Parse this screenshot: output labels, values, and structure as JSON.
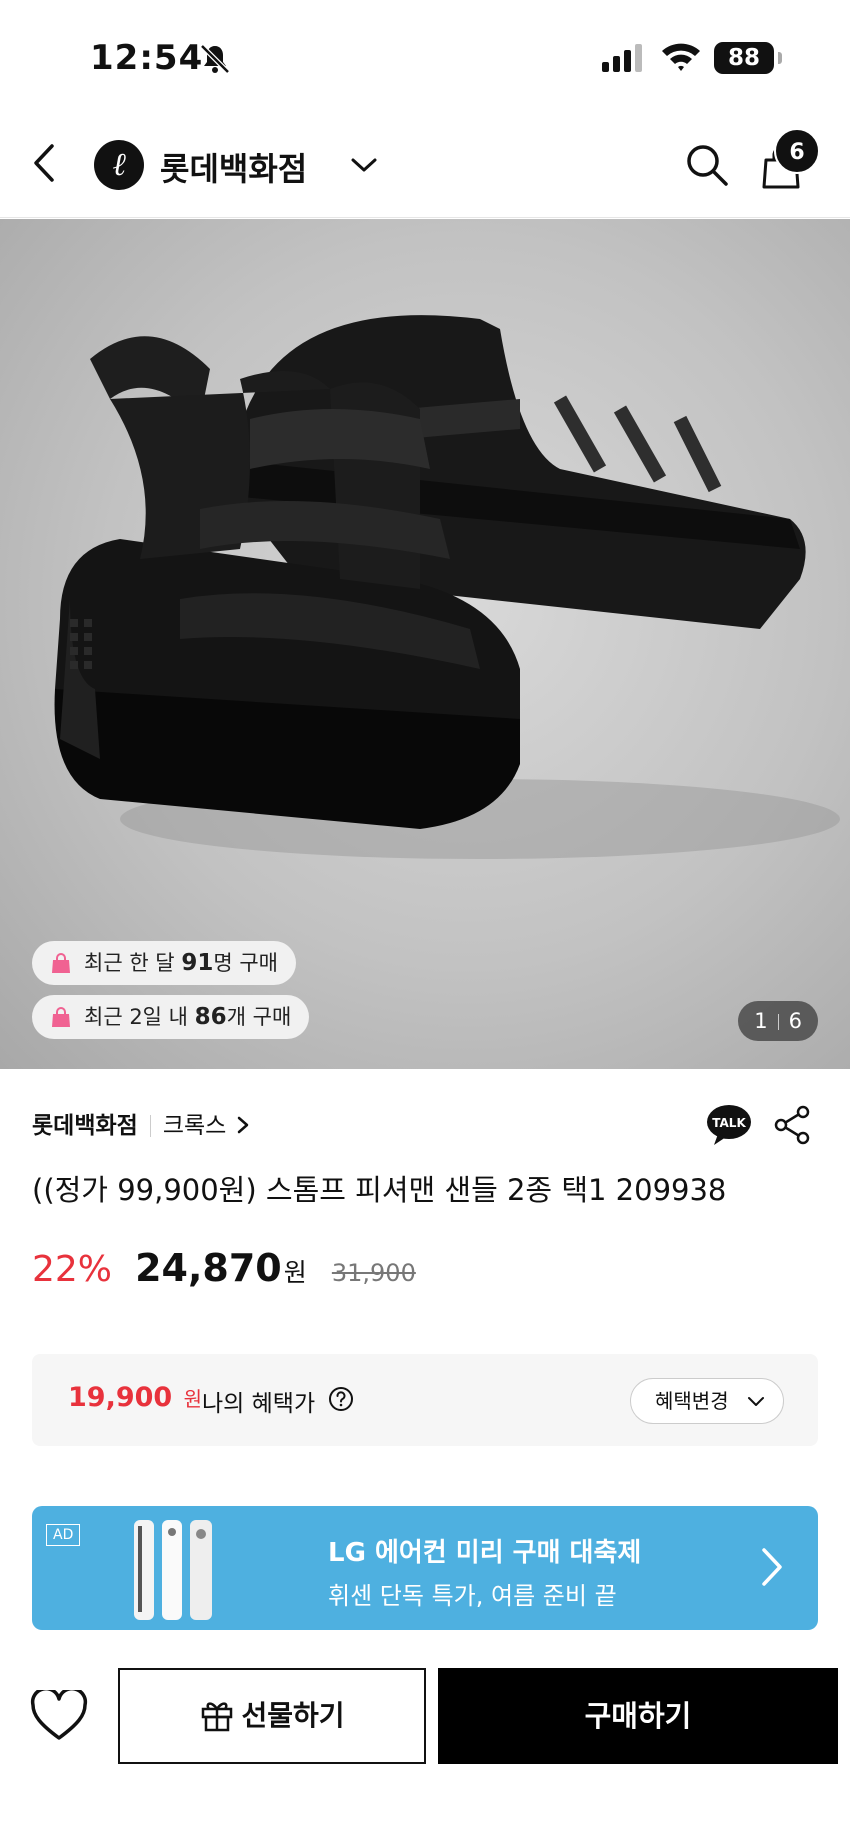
{
  "status_bar": {
    "time": "12:54",
    "battery": "88"
  },
  "nav": {
    "store_name": "롯데백화점",
    "cart_count": "6"
  },
  "hero": {
    "pill_1": {
      "prefix": "최근 한 달 ",
      "count": "91",
      "suffix": "명 구매"
    },
    "pill_2": {
      "prefix": "최근 2일 내 ",
      "count": "86",
      "suffix": "개 구매"
    },
    "page_current": "1",
    "page_total": "6"
  },
  "product": {
    "store": "롯데백화점",
    "brand": "크록스",
    "title": "((정가 99,900원) 스톰프 피셔맨 샌들 2종 택1 209938",
    "discount": "22%",
    "price": "24,870",
    "currency": "원",
    "original_price": "31,900"
  },
  "benefit": {
    "price": "19,900",
    "currency": "원",
    "label": "나의 혜택가",
    "change_label": "혜택변경"
  },
  "ad": {
    "tag": "AD",
    "title": "LG 에어컨 미리 구매 대축제",
    "subtitle": "휘센 단독 특가, 여름 준비 끝"
  },
  "bottom": {
    "gift_label": "선물하기",
    "buy_label": "구매하기",
    "talk_label": "TALK"
  },
  "colors": {
    "accent_red": "#e8323c",
    "ad_blue": "#4eb0e0",
    "pill_bag_pink": "#f06292"
  }
}
